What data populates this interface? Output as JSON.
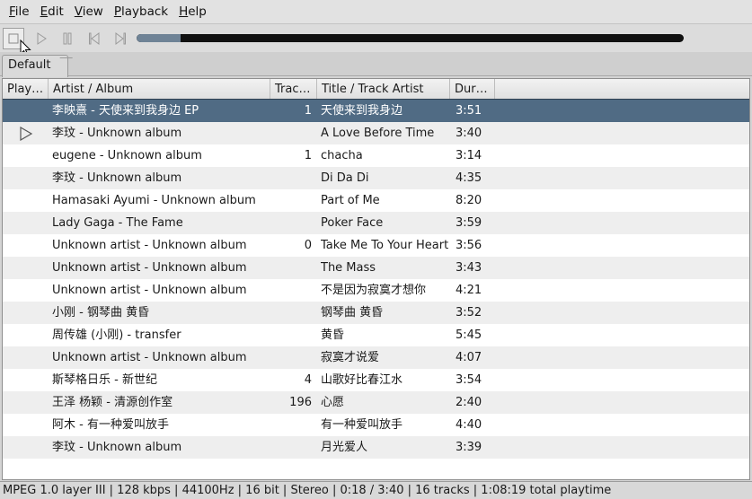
{
  "menu": [
    {
      "mnemonic": "F",
      "rest": "ile"
    },
    {
      "mnemonic": "E",
      "rest": "dit"
    },
    {
      "mnemonic": "V",
      "rest": "iew"
    },
    {
      "mnemonic": "P",
      "rest": "layback"
    },
    {
      "mnemonic": "H",
      "rest": "elp"
    }
  ],
  "toolbar": {
    "buttons": [
      "stop-icon",
      "play-icon",
      "pause-icon",
      "previous-icon",
      "next-icon"
    ],
    "seek_progress": 0.08,
    "volume_level": 1.0
  },
  "tab": {
    "label": "Default"
  },
  "columns": {
    "playing": "Play…",
    "artist_album": "Artist / Album",
    "track": "Trac…",
    "title": "Title / Track Artist",
    "duration": "Dur…"
  },
  "rows": [
    {
      "artist_album": "李映熹 - 天使来到我身边 EP",
      "track": "1",
      "title": "天使来到我身边",
      "duration": "3:51",
      "selected": true
    },
    {
      "artist_album": "李玟 - Unknown album",
      "track": "",
      "title": "A Love Before Time",
      "duration": "3:40",
      "playing": true
    },
    {
      "artist_album": "eugene - Unknown album",
      "track": "1",
      "title": "chacha",
      "duration": "3:14"
    },
    {
      "artist_album": "李玟 - Unknown album",
      "track": "",
      "title": "Di Da Di",
      "duration": "4:35"
    },
    {
      "artist_album": "Hamasaki Ayumi - Unknown album",
      "track": "",
      "title": "Part of Me",
      "duration": "8:20"
    },
    {
      "artist_album": "Lady Gaga - The Fame",
      "track": "",
      "title": "Poker Face",
      "duration": "3:59"
    },
    {
      "artist_album": "Unknown artist - Unknown album",
      "track": "0",
      "title": "Take Me To Your Heart",
      "duration": "3:56"
    },
    {
      "artist_album": "Unknown artist - Unknown album",
      "track": "",
      "title": "The Mass",
      "duration": "3:43"
    },
    {
      "artist_album": "Unknown artist - Unknown album",
      "track": "",
      "title": "不是因为寂寞才想你",
      "duration": "4:21"
    },
    {
      "artist_album": "小刚 - 钢琴曲 黄昏",
      "track": "",
      "title": "钢琴曲 黄昏",
      "duration": "3:52"
    },
    {
      "artist_album": "周传雄 (小刚) - transfer",
      "track": "",
      "title": "黄昏",
      "duration": "5:45"
    },
    {
      "artist_album": "Unknown artist - Unknown album",
      "track": "",
      "title": "寂寞才说爱",
      "duration": "4:07"
    },
    {
      "artist_album": "斯琴格日乐 - 新世纪",
      "track": "4",
      "title": "山歌好比春江水",
      "duration": "3:54"
    },
    {
      "artist_album": "王泽 杨颖 - 清源创作室",
      "track": "196",
      "title": "心愿",
      "duration": "2:40"
    },
    {
      "artist_album": "阿木 - 有一种爱叫放手",
      "track": "",
      "title": "有一种爱叫放手",
      "duration": "4:40"
    },
    {
      "artist_album": "李玟 - Unknown album",
      "track": "",
      "title": "月光爱人",
      "duration": "3:39"
    }
  ],
  "status": "MPEG 1.0 layer III  |  128 kbps | 44100Hz | 16 bit | Stereo | 0:18 / 3:40 | 16 tracks | 1:08:19 total playtime",
  "colors": {
    "selection": "#506b84",
    "seek_fill": "#6f8396",
    "volume": "#4f6a84"
  }
}
